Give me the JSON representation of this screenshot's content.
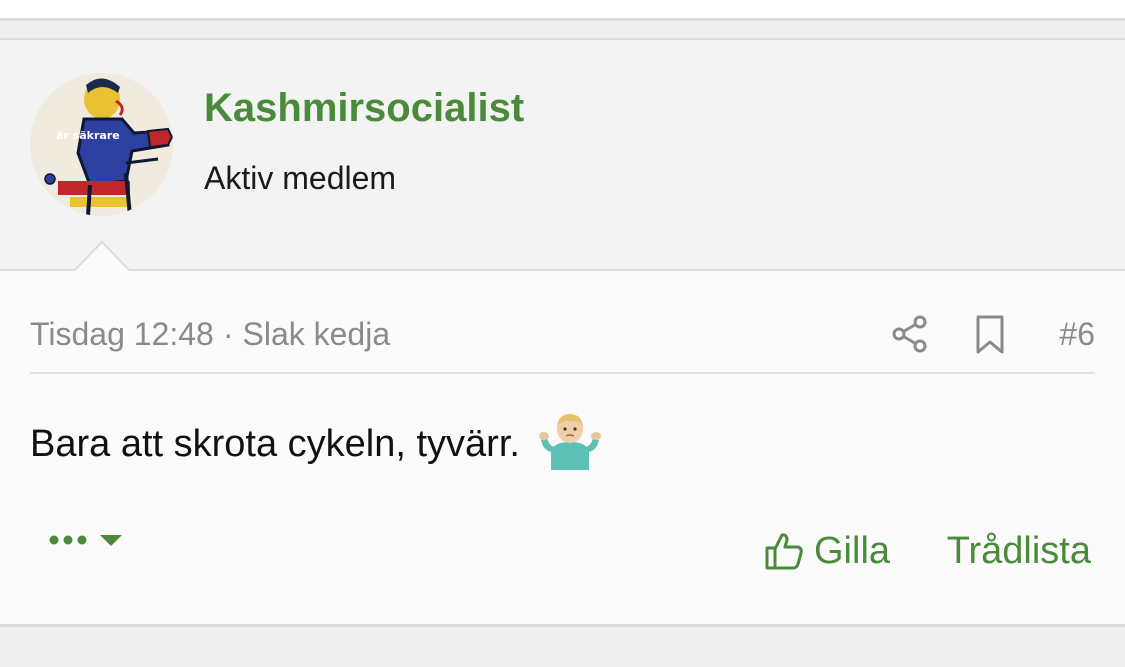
{
  "post": {
    "author": {
      "name": "Kashmirsocialist",
      "title": "Aktiv medlem",
      "avatar_text": "är säkrare"
    },
    "meta": {
      "time": "Tisdag 12:48",
      "separator": "·",
      "thread_title": "Slak kedja",
      "post_number": "#6"
    },
    "body": "Bara att skrota cykeln, tyvärr.",
    "emoji": "man-shrugging",
    "actions": {
      "like_label": "Gilla",
      "threadlist_label": "Trådlista"
    }
  },
  "icons": [
    "share-icon",
    "bookmark-icon",
    "more-dots-icon",
    "caret-down-icon",
    "thumbs-up-icon"
  ],
  "colors": {
    "accent_green": "#4a8a3b",
    "meta_gray": "#8a8a8a",
    "header_bg": "#f3f3f3",
    "post_bg": "#fbfbfb",
    "divider": "#dcdcdc"
  }
}
